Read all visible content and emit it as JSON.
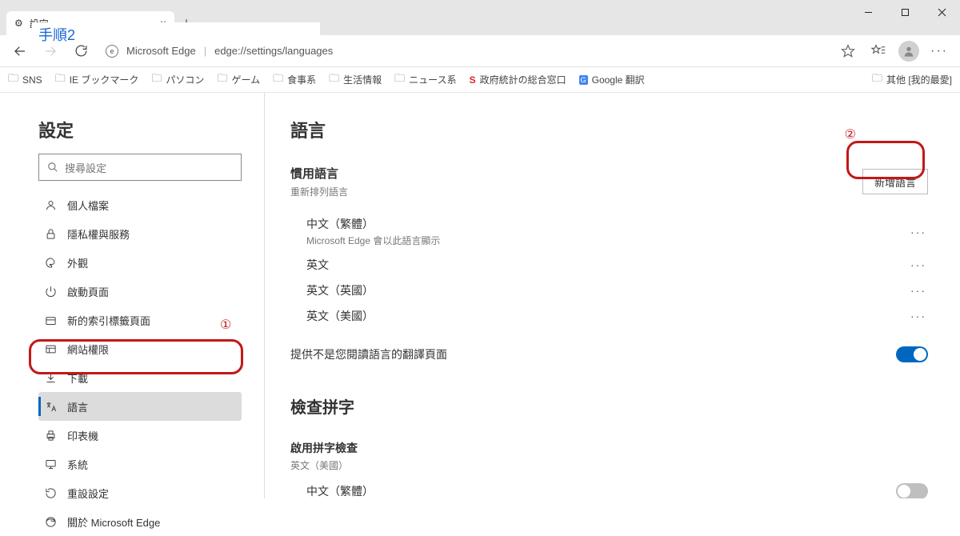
{
  "window": {
    "tab_title": "設定",
    "annotation": "手順2"
  },
  "toolbar": {
    "app_label": "Microsoft Edge",
    "url": "edge://settings/languages"
  },
  "bookmarks": {
    "items": [
      "SNS",
      "IE ブックマーク",
      "パソコン",
      "ゲーム",
      "食事系",
      "生活情報",
      "ニュース系"
    ],
    "gov": "政府統計の総合窓口",
    "gov_badge": "S",
    "translate": "Google 翻訳",
    "translate_badge": "G",
    "overflow": "其他 [我的最愛]"
  },
  "sidebar": {
    "title": "設定",
    "search_placeholder": "搜尋設定",
    "items": [
      {
        "label": "個人檔案"
      },
      {
        "label": "隱私權與服務"
      },
      {
        "label": "外觀"
      },
      {
        "label": "啟動頁面"
      },
      {
        "label": "新的索引標籤頁面"
      },
      {
        "label": "網站權限"
      },
      {
        "label": "下載"
      },
      {
        "label": "語言"
      },
      {
        "label": "印表機"
      },
      {
        "label": "系統"
      },
      {
        "label": "重設設定"
      },
      {
        "label": "關於 Microsoft Edge"
      }
    ]
  },
  "main": {
    "heading": "語言",
    "preferred_heading": "慣用語言",
    "preferred_desc": "重新排列語言",
    "add_button": "新增語言",
    "languages": [
      {
        "name": "中文（繁體）",
        "note": "Microsoft Edge 會以此語言顯示"
      },
      {
        "name": "英文"
      },
      {
        "name": "英文（英國）"
      },
      {
        "name": "英文（美國）"
      }
    ],
    "translate_opt": "提供不是您閱讀語言的翻譯頁面",
    "spell_heading": "檢查拼字",
    "spell_sub": "啟用拼字檢查",
    "spell_note": "英文（美國）",
    "spell_item": "中文（繁體）"
  },
  "anno": {
    "one": "①",
    "two": "②"
  }
}
